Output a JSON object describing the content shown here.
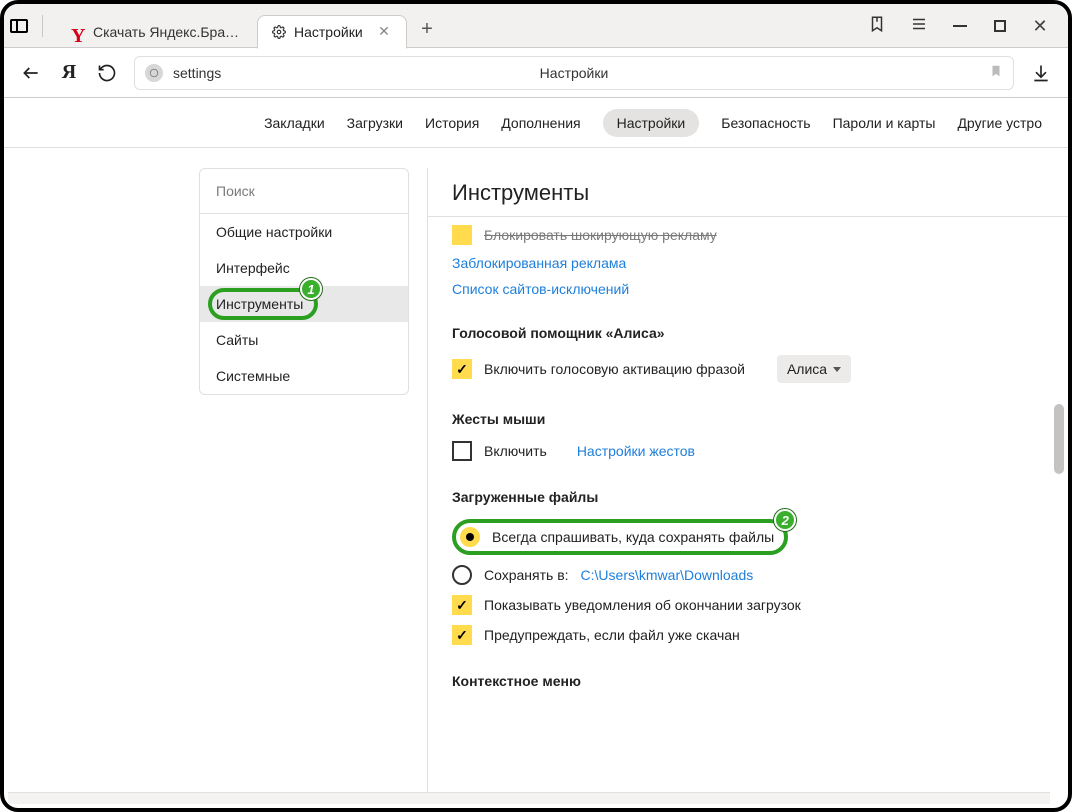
{
  "tabs": {
    "inactive_title": "Скачать Яндекс.Браузер д",
    "active_title": "Настройки",
    "favicon_inactive": "Y",
    "favicon_active_name": "gear-icon"
  },
  "addressbar": {
    "url_text": "settings",
    "center_title": "Настройки"
  },
  "subtabs": [
    "Закладки",
    "Загрузки",
    "История",
    "Дополнения",
    "Настройки",
    "Безопасность",
    "Пароли и карты",
    "Другие устро"
  ],
  "subtab_selected_index": 4,
  "sidebar": {
    "search_placeholder": "Поиск",
    "items": [
      "Общие настройки",
      "Интерфейс",
      "Инструменты",
      "Сайты",
      "Системные"
    ],
    "selected_index": 2
  },
  "content": {
    "title": "Инструменты",
    "ad_block_line": "Блокировать шокирующую рекламу",
    "link1": "Заблокированная реклама",
    "link2": "Список сайтов-исключений",
    "alice": {
      "title": "Голосовой помощник «Алиса»",
      "label": "Включить голосовую активацию фразой",
      "dropdown_value": "Алиса"
    },
    "mouse": {
      "title": "Жесты мыши",
      "label": "Включить",
      "link": "Настройки жестов"
    },
    "downloads": {
      "title": "Загруженные файлы",
      "always_ask": "Всегда спрашивать, куда сохранять файлы",
      "save_to_label": "Сохранять в:",
      "save_to_path": "C:\\Users\\kmwar\\Downloads",
      "notify_done": "Показывать уведомления об окончании загрузок",
      "warn_dup": "Предупреждать, если файл уже скачан"
    },
    "context_menu_title": "Контекстное меню"
  },
  "badges": {
    "one": "1",
    "two": "2"
  }
}
